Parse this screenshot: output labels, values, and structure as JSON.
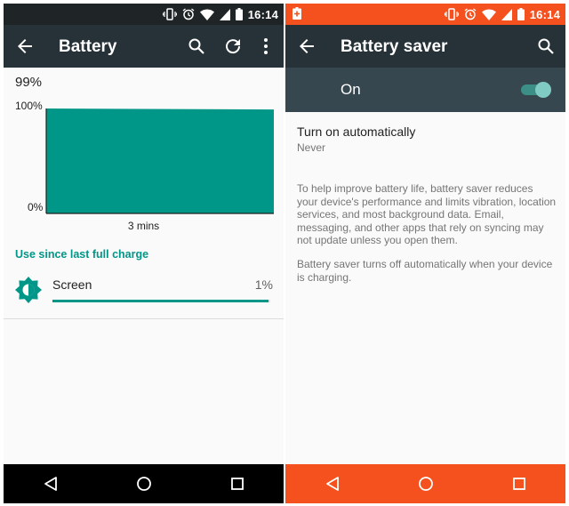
{
  "status_bar": {
    "time": "16:14"
  },
  "left_screen": {
    "title": "Battery",
    "current_percent": "99%",
    "chart_data": {
      "type": "area",
      "title": "",
      "y_tick_labels": [
        "100%",
        "0%"
      ],
      "xlabel": "3 mins",
      "ylim": [
        0,
        100
      ],
      "x": [
        0,
        3
      ],
      "values": [
        100,
        99
      ]
    },
    "section_header": "Use since last full charge",
    "usage_items": [
      {
        "label": "Screen",
        "percent_label": "1%",
        "fraction": 0.99
      }
    ],
    "colors": {
      "accent": "#009688",
      "appbar": "#263238"
    }
  },
  "right_screen": {
    "title": "Battery saver",
    "switch_label": "On",
    "switch_on": true,
    "auto_title": "Turn on automatically",
    "auto_value": "Never",
    "paragraph_1": "To help improve battery life, battery saver reduces your device's performance and limits vibration, location services, and most background data. Email, messaging, and other apps that rely on syncing may not update unless you open them.",
    "paragraph_2": "Battery saver turns off automatically when your device is charging.",
    "colors": {
      "status_bar": "#f4511e",
      "switch_bar": "#37474f"
    }
  },
  "icons": {
    "status": [
      "vibrate-icon",
      "alarm-icon",
      "wifi-icon",
      "signal-icon",
      "battery-icon"
    ],
    "nav": [
      "back-icon",
      "home-icon",
      "recents-icon"
    ]
  }
}
